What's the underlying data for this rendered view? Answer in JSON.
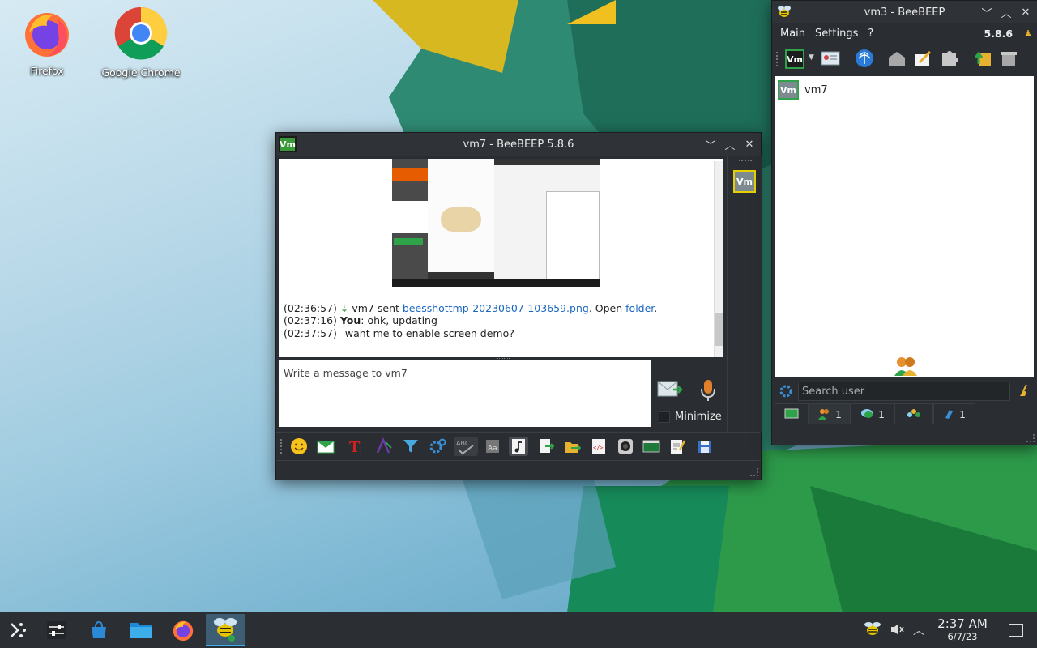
{
  "desktop": {
    "icons": [
      {
        "label": "Firefox"
      },
      {
        "label": "Google Chrome"
      }
    ]
  },
  "chat_window": {
    "title": "vm7 - BeeBEEP 5.8.6",
    "badge": "Vm",
    "messages": [
      {
        "time": "(02:36:57)",
        "sender": "vm7 sent",
        "link": "beesshottmp-20230607-103659.png",
        "after": ". Open",
        "link2": "folder",
        "end": "."
      },
      {
        "time": "(02:37:16)",
        "sender": "You",
        "text": ": ohk, updating"
      },
      {
        "time": "(02:37:57)",
        "text": "want me to enable screen demo?"
      }
    ],
    "input_placeholder": "Write a message to vm7",
    "minimize_label": "Minimize",
    "participant_badge": "Vm"
  },
  "main_window": {
    "title": "vm3 - BeeBEEP",
    "menu": [
      "Main",
      "Settings",
      "?"
    ],
    "version": "5.8.6",
    "status_badge": "Vm",
    "users": [
      {
        "name": "vm7",
        "badge": "Vm"
      }
    ],
    "search_placeholder": "Search user",
    "tabs": [
      {
        "icon": "monitor-icon",
        "count": ""
      },
      {
        "icon": "users-icon",
        "count": "1"
      },
      {
        "icon": "chat-icon",
        "count": "1"
      },
      {
        "icon": "group-icon",
        "count": ""
      },
      {
        "icon": "file-icon",
        "count": "1"
      }
    ]
  },
  "taskbar": {
    "time": "2:37 AM",
    "date": "6/7/23"
  },
  "colors": {
    "accent": "#3daee9",
    "vm_green": "#3a9a3a",
    "highlight_yellow": "#e6d000"
  }
}
